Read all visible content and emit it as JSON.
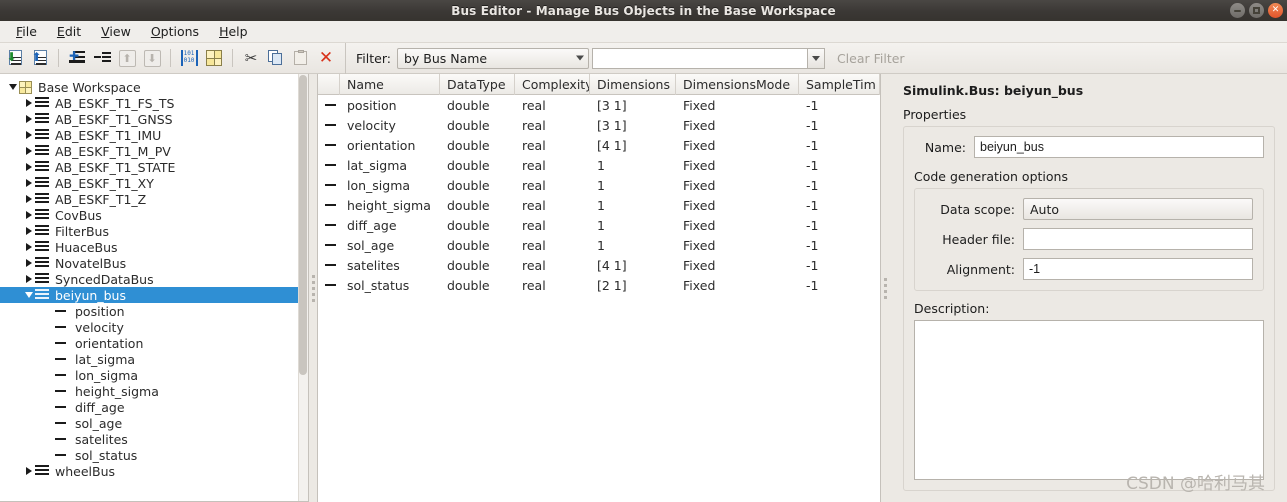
{
  "window": {
    "title": "Bus Editor - Manage Bus Objects in the Base Workspace",
    "minimize_label": "–",
    "maximize_label": "□",
    "close_label": "×"
  },
  "menubar": {
    "items": [
      {
        "label": "File",
        "mnemonic": "F",
        "rest": "ile"
      },
      {
        "label": "Edit",
        "mnemonic": "E",
        "rest": "dit"
      },
      {
        "label": "View",
        "mnemonic": "V",
        "rest": "iew"
      },
      {
        "label": "Options",
        "mnemonic": "O",
        "rest": "ptions"
      },
      {
        "label": "Help",
        "mnemonic": "H",
        "rest": "elp"
      }
    ]
  },
  "toolbar": {
    "buttons": [
      {
        "name": "import-bus-icon",
        "tooltip": "Import bus objects"
      },
      {
        "name": "export-bus-icon",
        "tooltip": "Export bus objects"
      },
      {
        "name": "add-bus-icon",
        "tooltip": "Add bus"
      },
      {
        "name": "add-bus-element-icon",
        "tooltip": "Add bus element"
      },
      {
        "name": "move-up-icon",
        "tooltip": "Move up"
      },
      {
        "name": "move-down-icon",
        "tooltip": "Move down"
      },
      {
        "name": "bit-fields-icon",
        "tooltip": "Bit fields"
      },
      {
        "name": "base-workspace-icon",
        "tooltip": "Base workspace"
      },
      {
        "name": "cut-icon",
        "tooltip": "Cut"
      },
      {
        "name": "copy-icon",
        "tooltip": "Copy"
      },
      {
        "name": "paste-icon",
        "tooltip": "Paste"
      },
      {
        "name": "delete-icon",
        "tooltip": "Delete"
      }
    ],
    "binary_top": "101",
    "binary_bottom": "010"
  },
  "filter": {
    "label": "Filter:",
    "mode_value": "by Bus Name",
    "input_value": "",
    "input_placeholder": "",
    "clear_label": "Clear Filter"
  },
  "tree": {
    "root": {
      "label": "Base Workspace",
      "expanded": true
    },
    "buses": [
      {
        "label": "AB_ESKF_T1_FS_TS",
        "expanded": false
      },
      {
        "label": "AB_ESKF_T1_GNSS",
        "expanded": false
      },
      {
        "label": "AB_ESKF_T1_IMU",
        "expanded": false
      },
      {
        "label": "AB_ESKF_T1_M_PV",
        "expanded": false
      },
      {
        "label": "AB_ESKF_T1_STATE",
        "expanded": false
      },
      {
        "label": "AB_ESKF_T1_XY",
        "expanded": false
      },
      {
        "label": "AB_ESKF_T1_Z",
        "expanded": false
      },
      {
        "label": "CovBus",
        "expanded": false
      },
      {
        "label": "FilterBus",
        "expanded": false
      },
      {
        "label": "HuaceBus",
        "expanded": false
      },
      {
        "label": "NovatelBus",
        "expanded": false
      },
      {
        "label": "SyncedDataBus",
        "expanded": false
      }
    ],
    "selected": {
      "label": "beiyun_bus",
      "expanded": true
    },
    "selected_children": [
      "position",
      "velocity",
      "orientation",
      "lat_sigma",
      "lon_sigma",
      "height_sigma",
      "diff_age",
      "sol_age",
      "satelites",
      "sol_status"
    ],
    "trailing": [
      {
        "label": "wheelBus",
        "expanded": false
      }
    ]
  },
  "table": {
    "columns": [
      "Name",
      "DataType",
      "Complexity",
      "Dimensions",
      "DimensionsMode",
      "SampleTim"
    ],
    "rows": [
      {
        "name": "position",
        "datatype": "double",
        "complexity": "real",
        "dimensions": "[3 1]",
        "dimensionsmode": "Fixed",
        "sampletime": "-1"
      },
      {
        "name": "velocity",
        "datatype": "double",
        "complexity": "real",
        "dimensions": "[3 1]",
        "dimensionsmode": "Fixed",
        "sampletime": "-1"
      },
      {
        "name": "orientation",
        "datatype": "double",
        "complexity": "real",
        "dimensions": "[4 1]",
        "dimensionsmode": "Fixed",
        "sampletime": "-1"
      },
      {
        "name": "lat_sigma",
        "datatype": "double",
        "complexity": "real",
        "dimensions": "1",
        "dimensionsmode": "Fixed",
        "sampletime": "-1"
      },
      {
        "name": "lon_sigma",
        "datatype": "double",
        "complexity": "real",
        "dimensions": "1",
        "dimensionsmode": "Fixed",
        "sampletime": "-1"
      },
      {
        "name": "height_sigma",
        "datatype": "double",
        "complexity": "real",
        "dimensions": "1",
        "dimensionsmode": "Fixed",
        "sampletime": "-1"
      },
      {
        "name": "diff_age",
        "datatype": "double",
        "complexity": "real",
        "dimensions": "1",
        "dimensionsmode": "Fixed",
        "sampletime": "-1"
      },
      {
        "name": "sol_age",
        "datatype": "double",
        "complexity": "real",
        "dimensions": "1",
        "dimensionsmode": "Fixed",
        "sampletime": "-1"
      },
      {
        "name": "satelites",
        "datatype": "double",
        "complexity": "real",
        "dimensions": "[4 1]",
        "dimensionsmode": "Fixed",
        "sampletime": "-1"
      },
      {
        "name": "sol_status",
        "datatype": "double",
        "complexity": "real",
        "dimensions": "[2 1]",
        "dimensionsmode": "Fixed",
        "sampletime": "-1"
      }
    ]
  },
  "properties": {
    "heading": "Simulink.Bus: beiyun_bus",
    "section_label": "Properties",
    "name_label": "Name:",
    "name_value": "beiyun_bus",
    "codegen_label": "Code generation options",
    "datascope_label": "Data scope:",
    "datascope_value": "Auto",
    "headerfile_label": "Header file:",
    "headerfile_value": "",
    "alignment_label": "Alignment:",
    "alignment_value": "-1",
    "description_label": "Description:",
    "description_value": ""
  },
  "watermark": "CSDN @哈利马其",
  "colors": {
    "titlebar": "#3b3835",
    "selection": "#2f8fd4",
    "close_button": "#e2542b",
    "panel_bg": "#ece9e4"
  }
}
